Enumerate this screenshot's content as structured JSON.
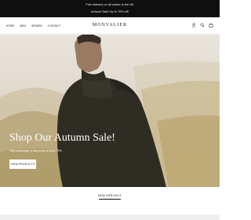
{
  "announcement": {
    "line1": "Free delivery on all orders in the UK",
    "line2": "Autumn Sale! Up to 75% off!"
  },
  "header": {
    "nav": [
      {
        "label": "HOME"
      },
      {
        "label": "MEN"
      },
      {
        "label": "WOMEN"
      },
      {
        "label": "CONTACT"
      }
    ],
    "logo": "MONVALIER",
    "icons": [
      "user-icon",
      "search-icon",
      "bag-icon"
    ]
  },
  "hero": {
    "title": "Shop Our Autumn Sale!",
    "subtitle": "Take advantage of discounts of up to 75%",
    "button_label": "VIEW PRODUCTS"
  },
  "new_arrivals": {
    "label": "NEW ARRIVALS"
  },
  "colors": {
    "announcement_bg": "#0f0f0f",
    "jacket": "#2f2d23",
    "hero_button_bg": "#ffffff"
  }
}
